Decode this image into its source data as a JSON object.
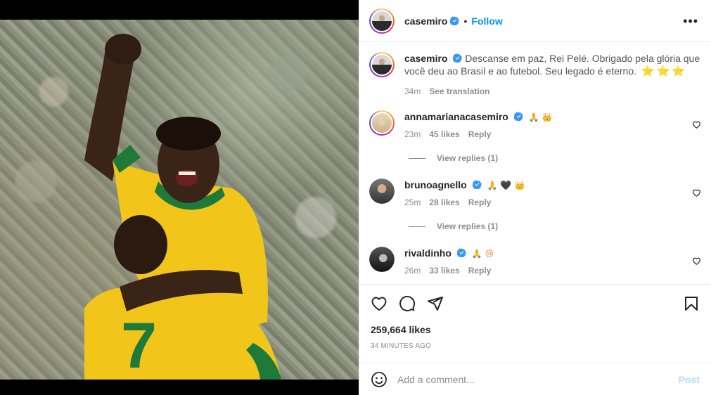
{
  "post": {
    "author": "casemiro",
    "follow_label": "Follow",
    "dot": "•",
    "more_label": "•••",
    "caption": "Descanse em paz, Rei Pelé. Obrigado pela glória que você deu ao Brasil e ao futebol. Seu legado é eterno.",
    "caption_emoji": [
      "⭐",
      "⭐",
      "⭐"
    ],
    "caption_time": "34m",
    "see_translation": "See translation",
    "likes": "259,664 likes",
    "time_ago": "34 MINUTES AGO",
    "image_jersey_number": "7"
  },
  "comments": [
    {
      "username": "annamarianacasemiro",
      "emoji": [
        "🙏",
        "👑"
      ],
      "time": "23m",
      "likes": "45 likes",
      "reply_label": "Reply",
      "view_replies": "View replies (1)"
    },
    {
      "username": "brunoagnello",
      "emoji": [
        "🙏",
        "🖤",
        "👑"
      ],
      "time": "25m",
      "likes": "28 likes",
      "reply_label": "Reply",
      "view_replies": "View replies (1)"
    },
    {
      "username": "rivaldinho",
      "emoji": [
        "🙏",
        "😢"
      ],
      "time": "26m",
      "likes": "33 likes",
      "reply_label": "Reply"
    }
  ],
  "add_comment": {
    "placeholder": "Add a comment...",
    "post_label": "Post"
  },
  "icons": [
    "verified-badge-icon",
    "more-options-icon",
    "heart-icon",
    "comment-icon",
    "share-icon",
    "bookmark-icon",
    "emoji-icon"
  ],
  "colors": {
    "accent": "#0095f6",
    "post_disabled": "#b3dbff",
    "verified": "#3897f0",
    "jersey_yellow": "#f2c51a",
    "jersey_green": "#1f7a3a"
  }
}
